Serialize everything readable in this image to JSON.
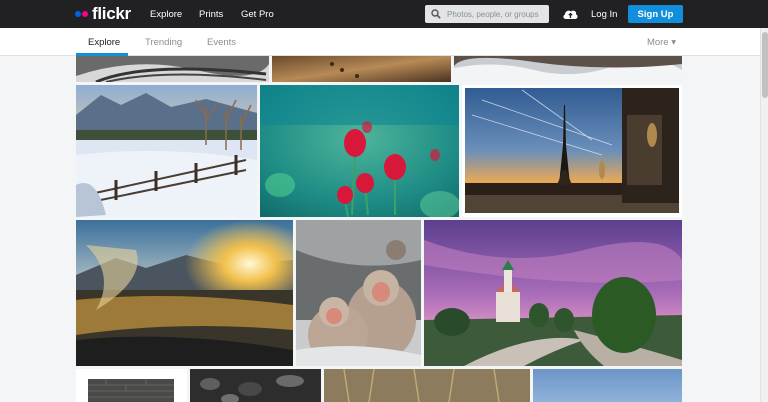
{
  "brand": {
    "name": "flickr",
    "dot_blue": "#0063dc",
    "dot_pink": "#ff0084"
  },
  "topnav": {
    "explore": "Explore",
    "prints": "Prints",
    "get_pro": "Get Pro"
  },
  "search": {
    "placeholder": "Photos, people, or groups"
  },
  "actions": {
    "upload_icon": "cloud-upload-icon",
    "login": "Log In",
    "signup": "Sign Up"
  },
  "subnav": {
    "tabs": [
      "Explore",
      "Trending",
      "Events"
    ],
    "more": "More ▾"
  },
  "colors": {
    "topbar": "#212124",
    "accent": "#128fdc"
  },
  "photos": [
    "tire-tracks-snow",
    "sand-footprints",
    "snowy-field",
    "snowy-fence-mountains",
    "red-tulips",
    "eiffel-tower-sunset",
    "hot-spring-steam-sunset",
    "snow-monkeys",
    "church-purple-sky",
    "brick-wall",
    "dark-leaves",
    "reeds",
    "blue-sky"
  ]
}
